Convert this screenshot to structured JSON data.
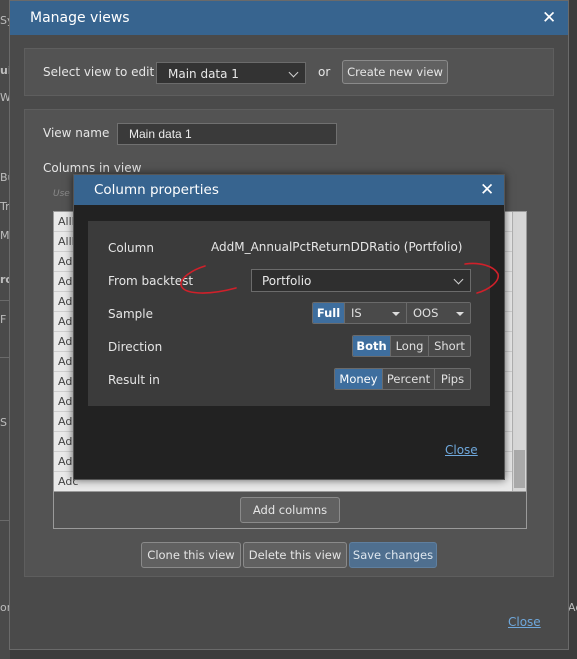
{
  "background_fragments": [
    "Sy",
    "ui",
    "W",
    "Bu",
    "Tr",
    "M",
    "ro",
    "F",
    "S",
    "ort",
    "Ad"
  ],
  "manage_views": {
    "title": "Manage views",
    "close_glyph": "✕",
    "select_label": "Select view to edit",
    "selected_view": "Main data 1",
    "or_label": "or",
    "create_new_label": "Create new view",
    "view_name_label": "View name",
    "view_name_value": "Main data 1",
    "columns_label": "Columns in view",
    "columns_hint": "Use",
    "column_rows": [
      "AllM",
      "AllM",
      "Adc",
      "Adc",
      "Adc",
      "Adc",
      "Adc",
      "Adc",
      "Adc",
      "Adc",
      "Adc",
      "Adc",
      "Adc",
      "Adc",
      "Adc"
    ],
    "add_columns_label": "Add columns",
    "clone_label": "Clone this view",
    "delete_label": "Delete this view",
    "save_label": "Save changes",
    "close_link": "Close"
  },
  "column_properties": {
    "title": "Column properties",
    "close_glyph": "✕",
    "column_label": "Column",
    "column_value": "AddM_AnnualPctReturnDDRatio (Portfolio)",
    "from_backtest_label": "From backtest",
    "from_backtest_value": "Portfolio",
    "sample_label": "Sample",
    "sample_full": "Full",
    "sample_is": "IS",
    "sample_oos": "OOS",
    "direction_label": "Direction",
    "direction_options": [
      "Both",
      "Long",
      "Short"
    ],
    "result_label": "Result in",
    "result_options": [
      "Money",
      "Percent",
      "Pips"
    ],
    "close_link": "Close"
  },
  "colors": {
    "title_bar": "#37648f",
    "selected_segment": "#3e6e9e",
    "annotation_red": "#d0202a"
  }
}
